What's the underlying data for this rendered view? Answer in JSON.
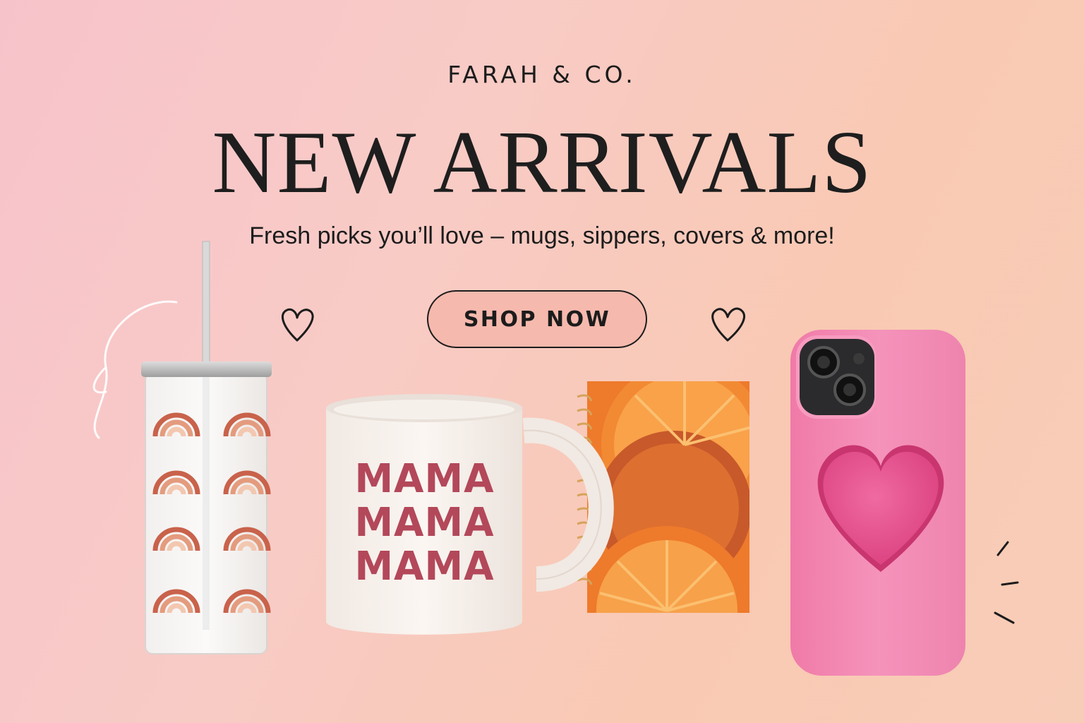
{
  "brand": "FARAH & CO.",
  "headline": "NEW ARRIVALS",
  "subtitle": "Fresh picks you’ll love – mugs, sippers, covers & more!",
  "cta": {
    "label": "SHOP NOW"
  },
  "mug": {
    "lines": [
      "MAMA",
      "MAMA",
      "MAMA"
    ],
    "text_color": "#b3485a"
  },
  "products": [
    "sipper-tumbler",
    "mama-mug",
    "orange-notebook",
    "pink-phone-case"
  ],
  "colors": {
    "accent": "#f6b9ad",
    "phone_case": "#f390b4",
    "heart": "#e8428a",
    "notebook": "#ee7a2b"
  }
}
